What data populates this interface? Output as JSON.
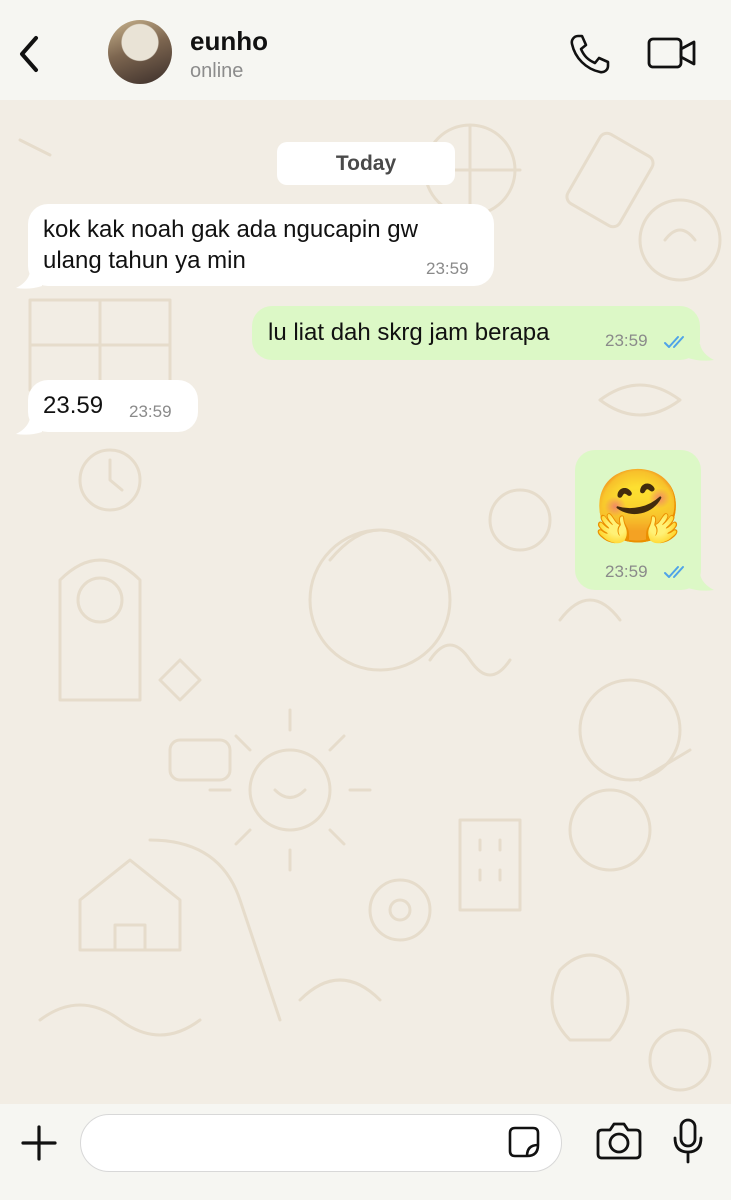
{
  "header": {
    "contact_name": "eunho",
    "status": "online"
  },
  "chat": {
    "date_label": "Today",
    "messages": [
      {
        "direction": "incoming",
        "lines": [
          "kok kak noah gak ada ngucapin gw",
          "ulang tahun ya min"
        ],
        "time": "23:59"
      },
      {
        "direction": "outgoing",
        "lines": [
          "lu liat dah skrg jam berapa"
        ],
        "time": "23:59",
        "read": true
      },
      {
        "direction": "incoming",
        "lines": [
          "23.59"
        ],
        "time": "23:59"
      },
      {
        "direction": "outgoing",
        "type": "emoji",
        "emoji": "🤗",
        "time": "23:59",
        "read": true
      }
    ]
  },
  "composer": {
    "placeholder": ""
  },
  "colors": {
    "incoming_bubble": "#ffffff",
    "outgoing_bubble": "#dcf8c6",
    "read_ticks": "#4fa3e8",
    "wallpaper": "#f2ede4",
    "doodle": "#e6dccb"
  },
  "icons": [
    "back-chevron-icon",
    "phone-icon",
    "video-camera-icon",
    "plus-icon",
    "sticker-icon",
    "camera-icon",
    "microphone-icon"
  ]
}
